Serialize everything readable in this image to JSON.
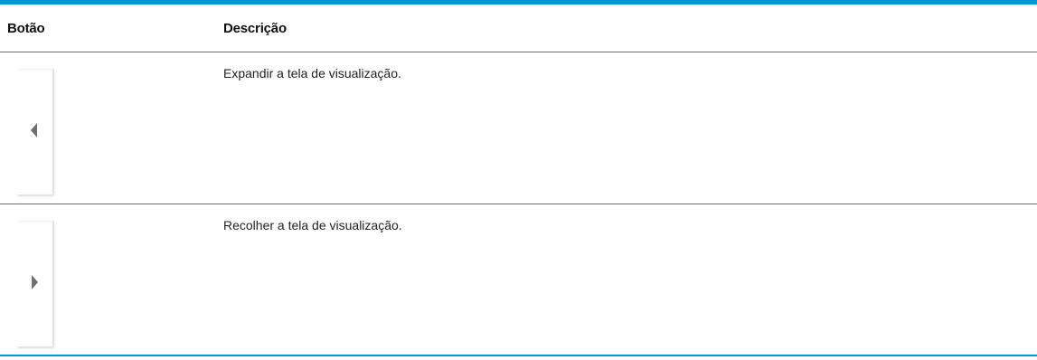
{
  "table": {
    "headers": {
      "button": "Botão",
      "description": "Descrição"
    },
    "rows": [
      {
        "icon": "chevron-left-icon",
        "description": "Expandir a tela de visualização."
      },
      {
        "icon": "chevron-right-icon",
        "description": "Recolher a tela de visualização."
      }
    ]
  },
  "colors": {
    "accent": "#0096d6",
    "arrow": "#6f6f6f"
  }
}
